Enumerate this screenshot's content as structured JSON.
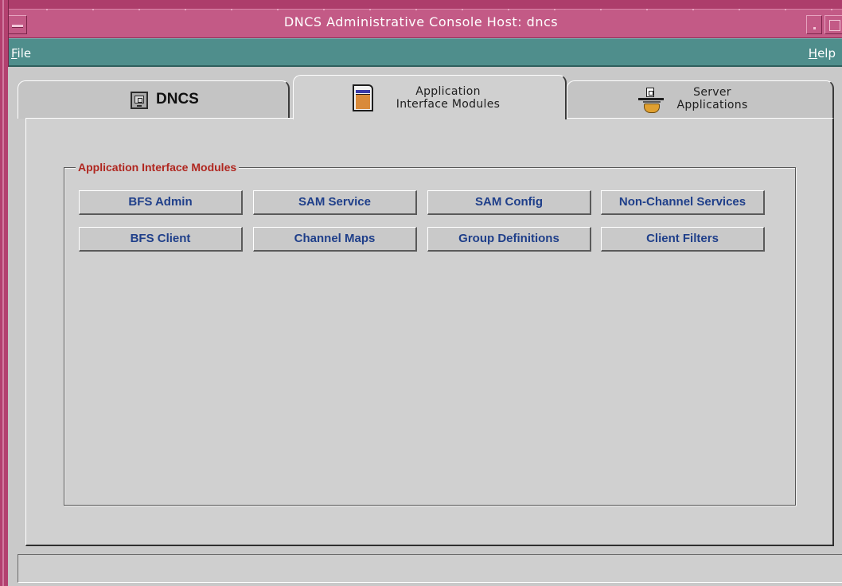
{
  "window": {
    "title": "DNCS Administrative Console   Host: dncs"
  },
  "menubar": {
    "items": [
      {
        "label": "File",
        "mnemonic": "F",
        "rest": "ile"
      },
      {
        "label": "Help",
        "mnemonic": "H",
        "rest": "elp"
      }
    ]
  },
  "tabs": [
    {
      "label": "DNCS",
      "icon": "computer-icon",
      "selected": false
    },
    {
      "label_line1": "Application",
      "label_line2": "Interface Modules",
      "icon": "document-icon",
      "selected": true
    },
    {
      "label_line1": "Server",
      "label_line2": "Applications",
      "icon": "server-hand-icon",
      "selected": false
    }
  ],
  "group": {
    "title": "Application Interface Modules"
  },
  "buttons": [
    "BFS Admin",
    "SAM Service",
    "SAM Config",
    "Non-Channel Services",
    "BFS Client",
    "Channel Maps",
    "Group Definitions",
    "Client Filters"
  ],
  "status": {
    "text": ""
  },
  "colors": {
    "titlebar": "#c35a86",
    "menubar": "#4f8e8c",
    "group_title": "#b0261f",
    "button_text": "#1f3f8a"
  }
}
